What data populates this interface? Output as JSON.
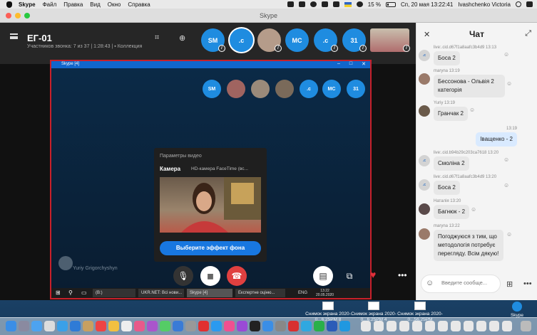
{
  "menubar": {
    "app": "Skype",
    "items": [
      "Файл",
      "Правка",
      "Вид",
      "Окно",
      "Справка"
    ],
    "battery": "15 %",
    "date_time": "Сп, 20 мая  13:22:41",
    "user": "Ivashchenko Victoria"
  },
  "window": {
    "title": "Skype"
  },
  "call": {
    "title": "ЕГ-01",
    "subtitle": "Участников звонка: 7 из 37 | 1:28:43 |",
    "collection": "Коллекция",
    "participants": [
      {
        "label": "SM",
        "color": "#1f8ce0"
      },
      {
        "label": ".c",
        "color": "#1f8ce0",
        "selected": true
      },
      {
        "label": "",
        "color": "#b59c8a"
      },
      {
        "label": "MC",
        "color": "#1f8ce0"
      },
      {
        "label": ".c",
        "color": "#1f8ce0"
      },
      {
        "label": "31",
        "color": "#1f8ce0"
      },
      {
        "label": "",
        "color": "#b06d6d"
      }
    ]
  },
  "shared_screen": {
    "window_title": "Skype [4]",
    "participants": [
      {
        "label": "SM",
        "color": "#1f8ce0"
      },
      {
        "label": "",
        "color": "#a06460"
      },
      {
        "label": "",
        "color": "#9a8a7a"
      },
      {
        "label": "",
        "color": "#7a6a5a"
      },
      {
        "label": ".c",
        "color": "#1f8ce0"
      },
      {
        "label": "MC",
        "color": "#1f8ce0"
      },
      {
        "label": "31",
        "color": "#1f8ce0"
      }
    ],
    "video_settings": {
      "header": "Параметры видео",
      "camera_label": "Камера",
      "camera_value": "HD-камера FaceTime (вс...",
      "effect_button": "Выберите эффект фона"
    },
    "watermark": "Yuriy Grigorchyshyn",
    "taskbar": {
      "items": [
        "(B:)",
        "UKR.NET: Всі нови...",
        "Skype [4]",
        "Експертне оціню..."
      ],
      "lang": "ENG",
      "time": "13:22",
      "date": "20.05.2020"
    }
  },
  "chat": {
    "title": "Чат",
    "messages": [
      {
        "sender": "live:.cid.d67f1a8aafc3b4d9 13:13",
        "text": "Боса 2",
        "avatar": ".c"
      },
      {
        "sender": "maryna 13:19",
        "text": "Бессонова - Ольвія 2 категорія",
        "avatar": ""
      },
      {
        "sender": "Yuriy 13:19",
        "text": "Гранчак 2",
        "avatar": ""
      },
      {
        "sender": "13:19",
        "text": "Іващенко - 2",
        "mine": true
      },
      {
        "sender": "live:.cid.b94b29c203ca7618 13:20",
        "text": "Смоліна 2",
        "avatar": ".c"
      },
      {
        "sender": "live:.cid.d67f1a8aafc3b4d9 13:20",
        "text": "Боса 2",
        "avatar": ".c"
      },
      {
        "sender": "Наталія 13:20",
        "text": "Багнюк - 2",
        "avatar": ""
      },
      {
        "sender": "maryna 13:22",
        "text": "Погоджуюся з тим, що методологія потребує перегляду. Всім дякую!",
        "avatar": ""
      }
    ],
    "input_placeholder": "Введите сообще..."
  },
  "desktop": {
    "icons": [
      "Снимок экрана 2020-0...6.25PM 8",
      "Снимок экрана 2020-0...6.25PM 4",
      "Снимок экрана 2020-0...56.25PM"
    ],
    "dock_app": "Skype"
  }
}
